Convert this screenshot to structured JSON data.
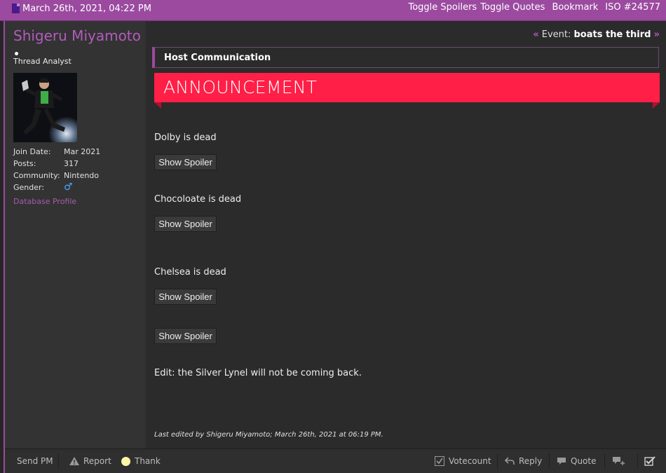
{
  "topbar": {
    "date": "March 26th, 2021, 04:22 PM",
    "links": [
      "Toggle Spoilers",
      "Toggle Quotes",
      "Bookmark",
      "ISO #24577"
    ]
  },
  "user": {
    "name": "Shigeru Miyamoto",
    "title": "Thread Analyst",
    "info": [
      {
        "key": "Join Date:",
        "value": "Mar 2021"
      },
      {
        "key": "Posts:",
        "value": "317"
      },
      {
        "key": "Community:",
        "value": "Nintendo"
      },
      {
        "key": "Gender:",
        "value": "♂"
      }
    ],
    "database_profile": "Database Profile"
  },
  "post": {
    "event_label": "Event:",
    "event_name": "boats the third",
    "host_box": "Host Communication",
    "banner": "ANNOUNCEMENT",
    "lines": [
      "Dolby is dead",
      "Chocoloate is dead",
      "Chelsea is dead",
      "Edit: the Silver Lynel will not be coming back."
    ],
    "spoiler_label": "Show Spoiler",
    "edited": "Last edited by Shigeru Miyamoto; March 26th, 2021 at 06:19 PM."
  },
  "bottombar": {
    "send_pm": "Send PM",
    "report": "Report",
    "thank": "Thank",
    "votecount": "Votecount",
    "reply": "Reply",
    "quote": "Quote"
  },
  "colors": {
    "accent": "#9b4aa0",
    "banner": "#ff1f47",
    "username": "#b35bbd"
  }
}
